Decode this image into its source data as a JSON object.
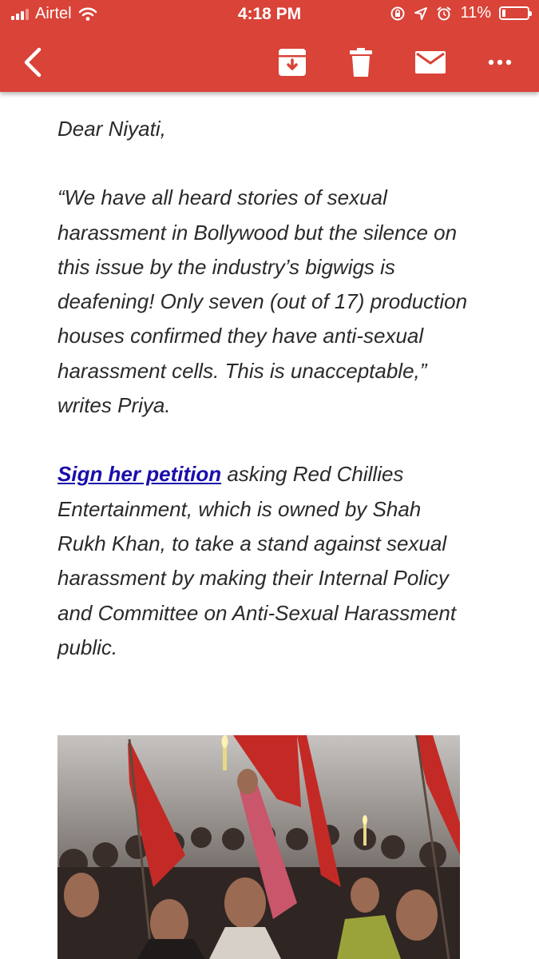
{
  "status_bar": {
    "carrier": "Airtel",
    "time": "4:18 PM",
    "battery": "11%"
  },
  "toolbar": {
    "icons": [
      "back-icon",
      "archive-icon",
      "trash-icon",
      "mail-icon",
      "more-icon"
    ]
  },
  "email": {
    "greeting": "Dear Niyati,",
    "quote": "“We have all heard stories of sexual harassment in Bollywood but the silence on this issue by the industry’s bigwigs is deafening! Only seven (out of 17) production houses confirmed they have anti-sexual harassment cells. This is unacceptable,” writes Priya.",
    "link_text": "Sign her petition",
    "petition_text": " asking Red Chillies Entertainment, which is owned by Shah Rukh Khan, to take a stand against sexual harassment by making their Internal Policy and Committee on Anti-Sexual Harassment public."
  },
  "colors": {
    "header_red": "#d94338",
    "link_blue": "#1a0dab",
    "body_text": "#2a2a2a"
  }
}
